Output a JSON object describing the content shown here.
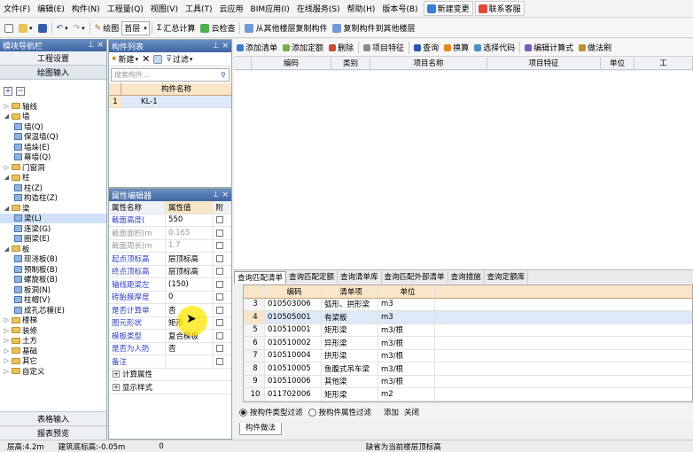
{
  "menu": [
    "文件(F)",
    "编辑(E)",
    "构件(N)",
    "工程量(Q)",
    "视图(V)",
    "工具(T)",
    "云应用",
    "BIM应用(I)",
    "在线服务(S)",
    "帮助(H)",
    "版本号(B)"
  ],
  "menu_buttons": [
    "新建变更",
    "联系客服"
  ],
  "toolbar": {
    "draw": "绘图",
    "layer": "首层",
    "sum": "汇总计算",
    "cloud_check": "云检查",
    "copy_from": "从其他楼层复制构件",
    "copy_to": "复制构件到其他楼层"
  },
  "nav": {
    "title": "模块导航栏",
    "project_settings": "工程设置",
    "draw_input": "绘图输入",
    "table_input": "表格输入",
    "report_preview": "报表预览"
  },
  "tree": [
    {
      "label": "轴线",
      "level": 0,
      "type": "folder",
      "toggle": "+"
    },
    {
      "label": "墙",
      "level": 0,
      "type": "folder",
      "toggle": "-"
    },
    {
      "label": "墙(Q)",
      "level": 1,
      "type": "leaf"
    },
    {
      "label": "保温墙(Q)",
      "level": 1,
      "type": "leaf"
    },
    {
      "label": "墙垛(E)",
      "level": 1,
      "type": "leaf"
    },
    {
      "label": "幕墙(Q)",
      "level": 1,
      "type": "leaf"
    },
    {
      "label": "门窗洞",
      "level": 0,
      "type": "folder",
      "toggle": "+"
    },
    {
      "label": "柱",
      "level": 0,
      "type": "folder",
      "toggle": "-"
    },
    {
      "label": "柱(Z)",
      "level": 1,
      "type": "leaf"
    },
    {
      "label": "构造柱(Z)",
      "level": 1,
      "type": "leaf"
    },
    {
      "label": "梁",
      "level": 0,
      "type": "folder",
      "toggle": "-"
    },
    {
      "label": "梁(L)",
      "level": 1,
      "type": "leaf",
      "selected": true
    },
    {
      "label": "连梁(G)",
      "level": 1,
      "type": "leaf"
    },
    {
      "label": "圈梁(E)",
      "level": 1,
      "type": "leaf"
    },
    {
      "label": "板",
      "level": 0,
      "type": "folder",
      "toggle": "-"
    },
    {
      "label": "现浇板(B)",
      "level": 1,
      "type": "leaf"
    },
    {
      "label": "预制板(B)",
      "level": 1,
      "type": "leaf"
    },
    {
      "label": "螺旋板(B)",
      "level": 1,
      "type": "leaf"
    },
    {
      "label": "板洞(N)",
      "level": 1,
      "type": "leaf"
    },
    {
      "label": "柱帽(V)",
      "level": 1,
      "type": "leaf"
    },
    {
      "label": "成孔芯模(E)",
      "level": 1,
      "type": "leaf"
    },
    {
      "label": "楼梯",
      "level": 0,
      "type": "folder",
      "toggle": "+"
    },
    {
      "label": "装修",
      "level": 0,
      "type": "folder",
      "toggle": "+"
    },
    {
      "label": "土方",
      "level": 0,
      "type": "folder",
      "toggle": "+"
    },
    {
      "label": "基础",
      "level": 0,
      "type": "folder",
      "toggle": "+"
    },
    {
      "label": "其它",
      "level": 0,
      "type": "folder",
      "toggle": "+"
    },
    {
      "label": "自定义",
      "level": 0,
      "type": "folder",
      "toggle": "+"
    }
  ],
  "clist": {
    "title": "构件列表",
    "new": "新建",
    "filter": "过滤",
    "search_placeholder": "搜索构件...",
    "col_name": "构件名称",
    "rows": [
      {
        "idx": "1",
        "name": "KL-1"
      }
    ]
  },
  "prop": {
    "title": "属性编辑器",
    "col_name": "属性名称",
    "col_value": "属性值",
    "col_attach": "附",
    "rows": [
      {
        "name": "截面高度(",
        "value": "550",
        "style": "blue"
      },
      {
        "name": "截面面积(m",
        "value": "0.165",
        "style": "gray"
      },
      {
        "name": "截面周长(m",
        "value": "1.7",
        "style": "gray"
      },
      {
        "name": "起点顶标高",
        "value": "层顶标高",
        "style": "blue"
      },
      {
        "name": "终点顶标高",
        "value": "层顶标高",
        "style": "blue"
      },
      {
        "name": "轴线距梁左",
        "value": "(150)",
        "style": "blue"
      },
      {
        "name": "砖胎膜厚度",
        "value": "0",
        "style": "blue"
      },
      {
        "name": "是否计算单",
        "value": "否",
        "style": "blue"
      },
      {
        "name": "图元形状",
        "value": "矩形",
        "style": "blue"
      },
      {
        "name": "模板类型",
        "value": "复合模板",
        "style": "blue"
      },
      {
        "name": "是否为人防",
        "value": "否",
        "style": "blue"
      },
      {
        "name": "备注",
        "value": "",
        "style": "blue"
      },
      {
        "name": "计算属性",
        "value": "",
        "style": "group"
      },
      {
        "name": "显示样式",
        "value": "",
        "style": "group"
      }
    ]
  },
  "rtool": [
    "添加清单",
    "添加定额",
    "删除",
    "项目特征",
    "查询",
    "换算",
    "选择代码",
    "编辑计算式",
    "做法刷"
  ],
  "rgrid_cols": [
    "编码",
    "类别",
    "项目名称",
    "项目特征",
    "单位",
    "工"
  ],
  "tabs": [
    "查询匹配清单",
    "查询匹配定额",
    "查询清单库",
    "查询匹配外部清单",
    "查询措施",
    "查询定额库"
  ],
  "lgrid": {
    "cols": [
      "编码",
      "清单项",
      "单位"
    ],
    "rows": [
      {
        "n": "3",
        "code": "010503006",
        "item": "弧形、拱形梁",
        "unit": "m3"
      },
      {
        "n": "4",
        "code": "010505001",
        "item": "有梁板",
        "unit": "m3",
        "sel": true
      },
      {
        "n": "5",
        "code": "010510001",
        "item": "矩形梁",
        "unit": "m3/根"
      },
      {
        "n": "6",
        "code": "010510002",
        "item": "异形梁",
        "unit": "m3/根"
      },
      {
        "n": "7",
        "code": "010510004",
        "item": "拱形梁",
        "unit": "m3/根"
      },
      {
        "n": "8",
        "code": "010510005",
        "item": "鱼腹式吊车梁",
        "unit": "m3/根"
      },
      {
        "n": "9",
        "code": "010510006",
        "item": "其他梁",
        "unit": "m3/根"
      },
      {
        "n": "10",
        "code": "011702006",
        "item": "矩形梁",
        "unit": "m2"
      }
    ]
  },
  "radios": {
    "opt1": "按构件类型过滤",
    "opt2": "按构件属性过滤",
    "add": "添加",
    "close": "关闭"
  },
  "bottom_tab": "构件做法",
  "status": {
    "floor_height": "层高:4.2m",
    "base_elev": "建筑底标高:-0.05m",
    "zero": "0",
    "hint": "缺省为当前楼层顶标高"
  }
}
